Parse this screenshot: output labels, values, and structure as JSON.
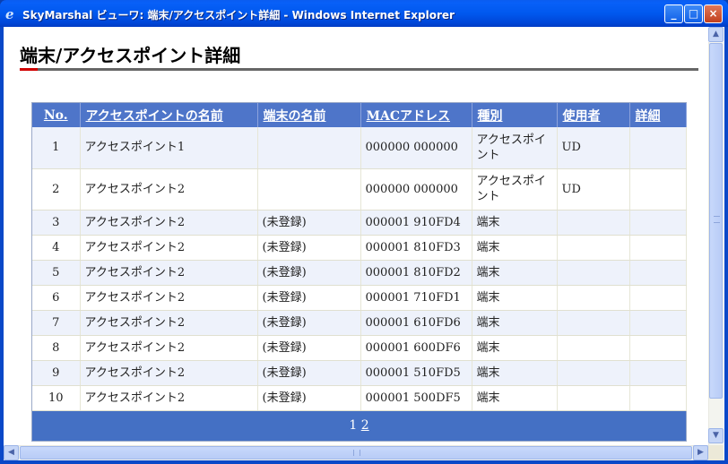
{
  "window": {
    "title": "SkyMarshal ビューワ: 端末/アクセスポイント詳細 - Windows Internet Explorer",
    "min_glyph": "_",
    "max_glyph": "□",
    "close_glyph": "×"
  },
  "page": {
    "title": "端末/アクセスポイント詳細"
  },
  "table": {
    "columns": [
      "No.",
      "アクセスポイントの名前",
      "端末の名前",
      "MACアドレス",
      "種別",
      "使用者",
      "詳細"
    ],
    "rows": [
      {
        "no": "1",
        "ap": "アクセスポイント1",
        "terminal": "",
        "mac": "000000 000000",
        "kind": "アクセスポイント",
        "user": "UD",
        "detail": ""
      },
      {
        "no": "2",
        "ap": "アクセスポイント2",
        "terminal": "",
        "mac": "000000 000000",
        "kind": "アクセスポイント",
        "user": "UD",
        "detail": ""
      },
      {
        "no": "3",
        "ap": "アクセスポイント2",
        "terminal": "(未登録)",
        "mac": "000001 910FD4",
        "kind": "端末",
        "user": "",
        "detail": ""
      },
      {
        "no": "4",
        "ap": "アクセスポイント2",
        "terminal": "(未登録)",
        "mac": "000001 810FD3",
        "kind": "端末",
        "user": "",
        "detail": ""
      },
      {
        "no": "5",
        "ap": "アクセスポイント2",
        "terminal": "(未登録)",
        "mac": "000001 810FD2",
        "kind": "端末",
        "user": "",
        "detail": ""
      },
      {
        "no": "6",
        "ap": "アクセスポイント2",
        "terminal": "(未登録)",
        "mac": "000001 710FD1",
        "kind": "端末",
        "user": "",
        "detail": ""
      },
      {
        "no": "7",
        "ap": "アクセスポイント2",
        "terminal": "(未登録)",
        "mac": "000001 610FD6",
        "kind": "端末",
        "user": "",
        "detail": ""
      },
      {
        "no": "8",
        "ap": "アクセスポイント2",
        "terminal": "(未登録)",
        "mac": "000001 600DF6",
        "kind": "端末",
        "user": "",
        "detail": ""
      },
      {
        "no": "9",
        "ap": "アクセスポイント2",
        "terminal": "(未登録)",
        "mac": "000001 510FD5",
        "kind": "端末",
        "user": "",
        "detail": ""
      },
      {
        "no": "10",
        "ap": "アクセスポイント2",
        "terminal": "(未登録)",
        "mac": "000001 500DF5",
        "kind": "端末",
        "user": "",
        "detail": ""
      }
    ],
    "pager": {
      "current": "1",
      "next": "2"
    }
  },
  "icons": {
    "title_icon": "ie-logo-icon",
    "scroll_up": "arrow-up-icon",
    "scroll_down": "arrow-down-icon",
    "scroll_left": "arrow-left-icon",
    "scroll_right": "arrow-right-icon"
  },
  "colors": {
    "header_bg": "#4e75c9",
    "pager_bg": "#4470c4",
    "row_alt": "#eef2fb",
    "title_accent": "#d00000"
  }
}
